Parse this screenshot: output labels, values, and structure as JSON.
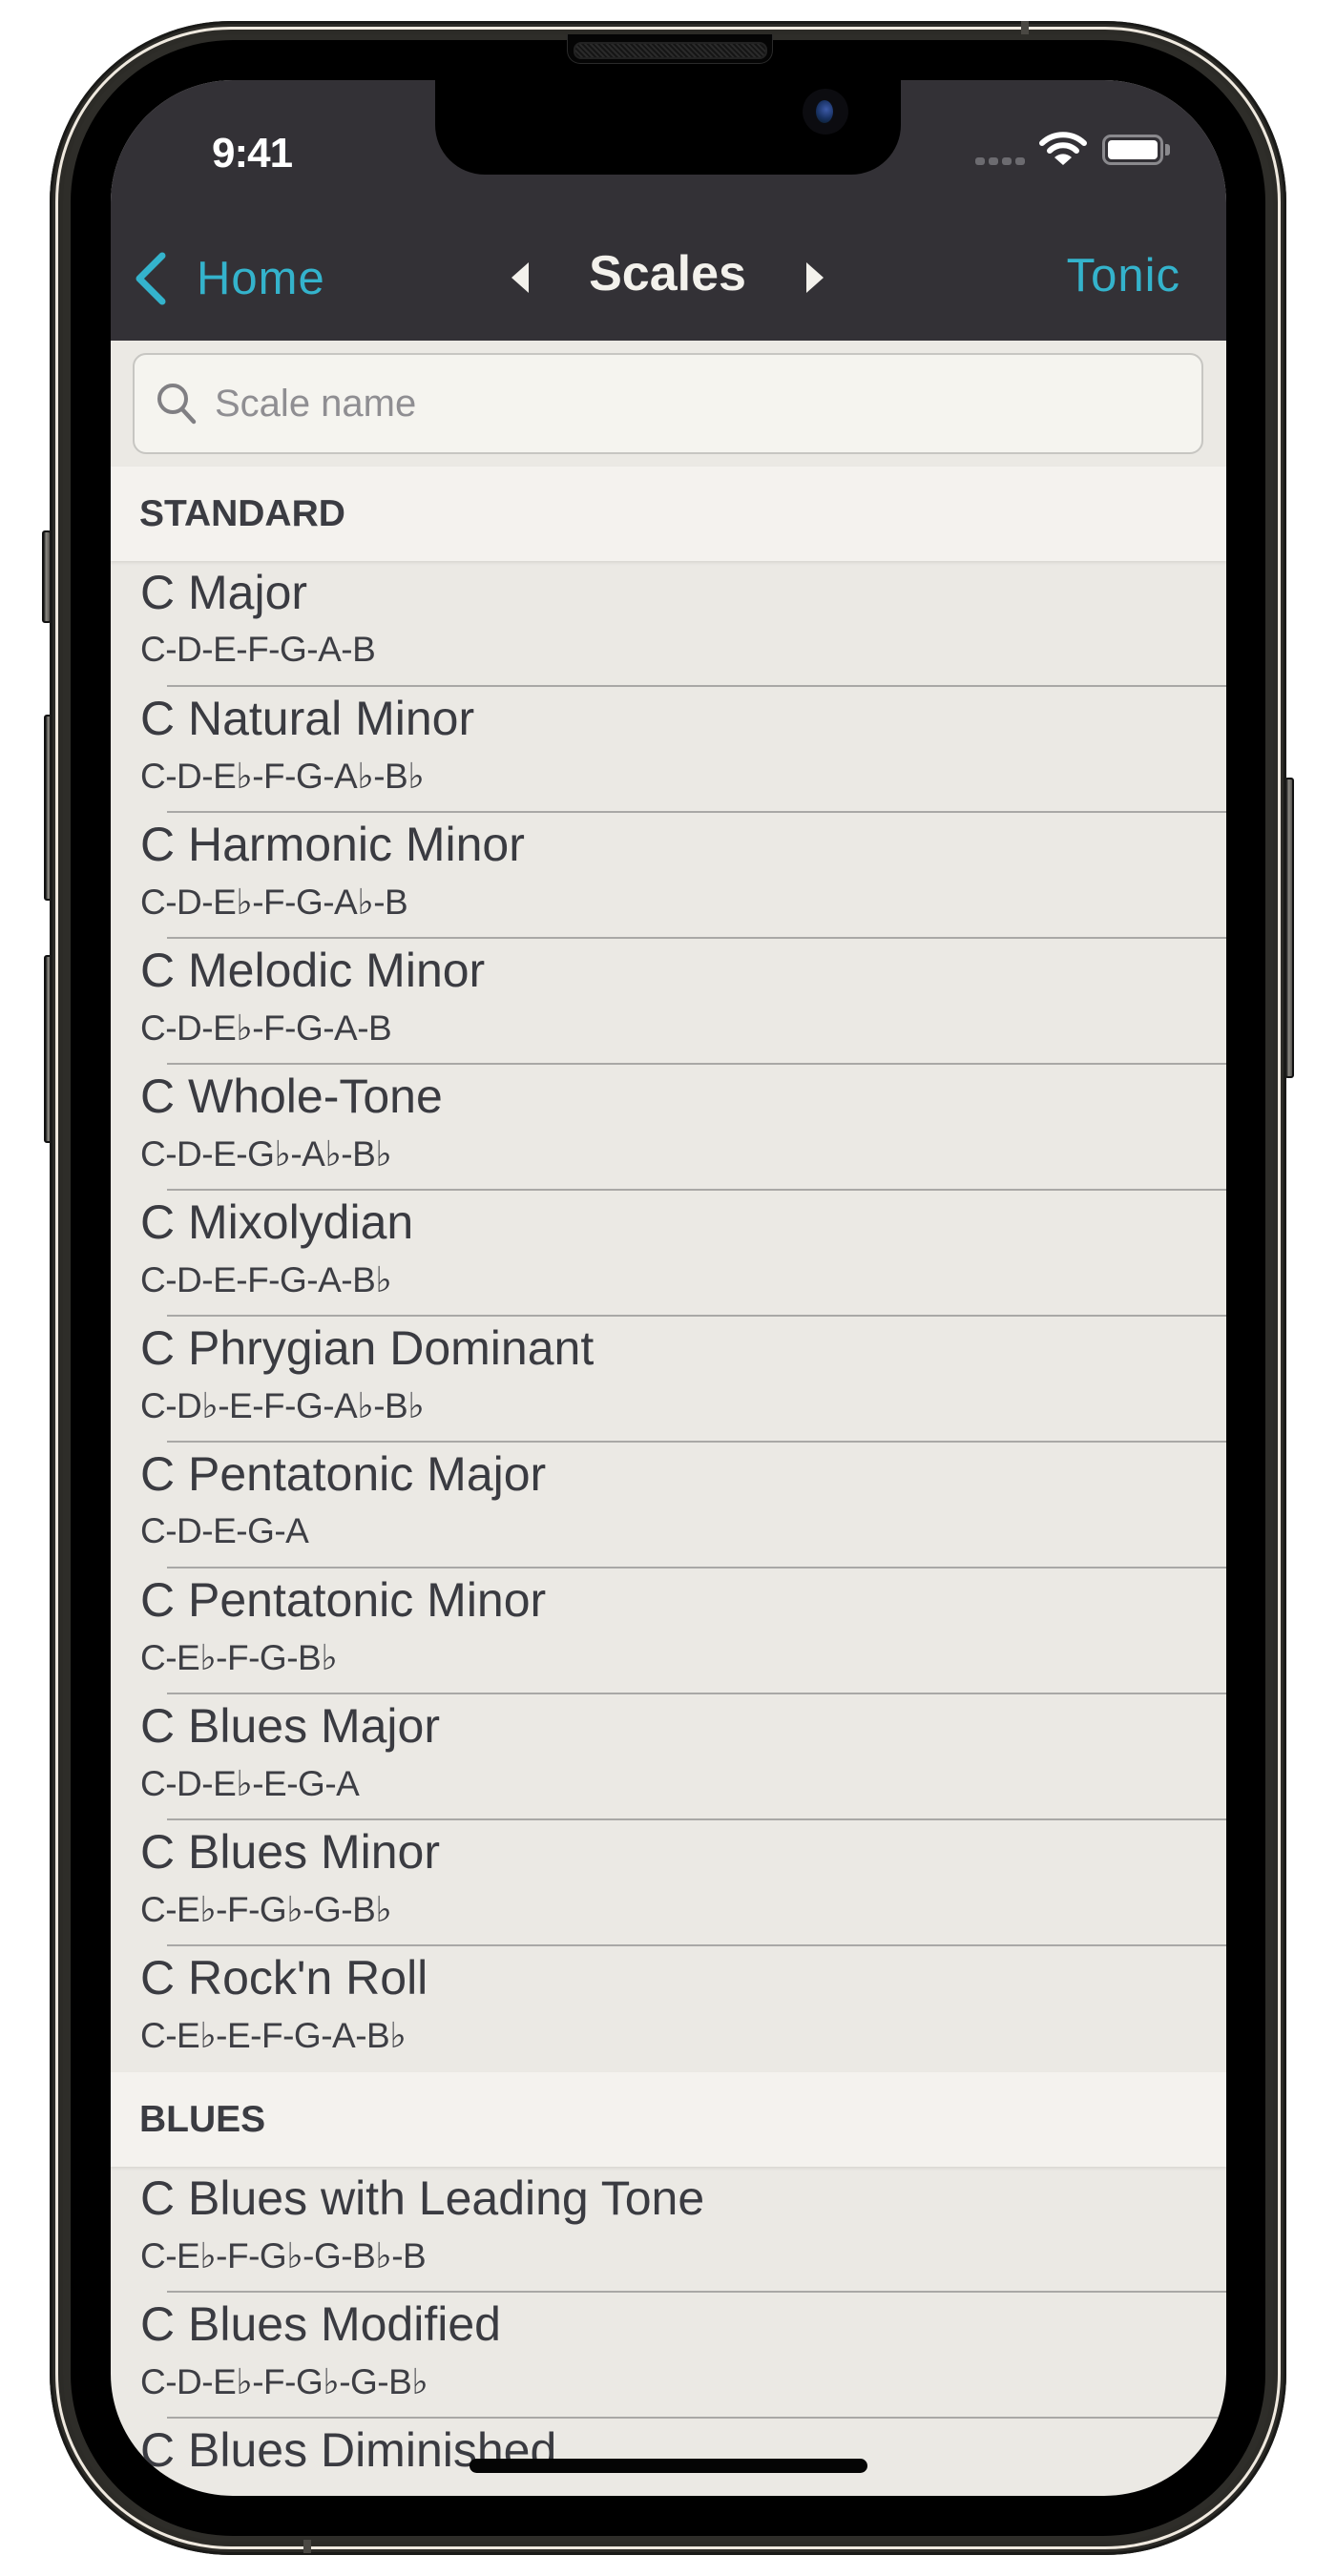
{
  "status_bar": {
    "time": "9:41",
    "signal_icon": "cellular-signal-icon",
    "wifi_icon": "wifi-icon",
    "battery_icon": "battery-icon"
  },
  "nav": {
    "back_label": "Home",
    "back_icon": "chevron-left-icon",
    "prev_icon": "triangle-left-icon",
    "title": "Scales",
    "next_icon": "triangle-right-icon",
    "right_label": "Tonic",
    "accent_color": "#34b3cc"
  },
  "search": {
    "placeholder": "Scale name",
    "value": "",
    "icon": "search-icon"
  },
  "sections": [
    {
      "header": "STANDARD",
      "items": [
        {
          "name": "C Major",
          "notes": "C-D-E-F-G-A-B"
        },
        {
          "name": "C Natural Minor",
          "notes": "C-D-E♭-F-G-A♭-B♭"
        },
        {
          "name": "C Harmonic Minor",
          "notes": "C-D-E♭-F-G-A♭-B"
        },
        {
          "name": "C Melodic Minor",
          "notes": "C-D-E♭-F-G-A-B"
        },
        {
          "name": "C Whole-Tone",
          "notes": "C-D-E-G♭-A♭-B♭"
        },
        {
          "name": "C Mixolydian",
          "notes": "C-D-E-F-G-A-B♭"
        },
        {
          "name": "C Phrygian Dominant",
          "notes": "C-D♭-E-F-G-A♭-B♭"
        },
        {
          "name": "C Pentatonic Major",
          "notes": "C-D-E-G-A"
        },
        {
          "name": "C Pentatonic Minor",
          "notes": "C-E♭-F-G-B♭"
        },
        {
          "name": "C Blues Major",
          "notes": "C-D-E♭-E-G-A"
        },
        {
          "name": "C Blues Minor",
          "notes": "C-E♭-F-G♭-G-B♭"
        },
        {
          "name": "C Rock'n Roll",
          "notes": "C-E♭-E-F-G-A-B♭"
        }
      ]
    },
    {
      "header": "BLUES",
      "items": [
        {
          "name": "C Blues with Leading Tone",
          "notes": "C-E♭-F-G♭-G-B♭-B"
        },
        {
          "name": "C Blues Modified",
          "notes": "C-D-E♭-F-G♭-G-B♭"
        },
        {
          "name": "C Blues Diminished",
          "notes": ""
        }
      ]
    }
  ]
}
